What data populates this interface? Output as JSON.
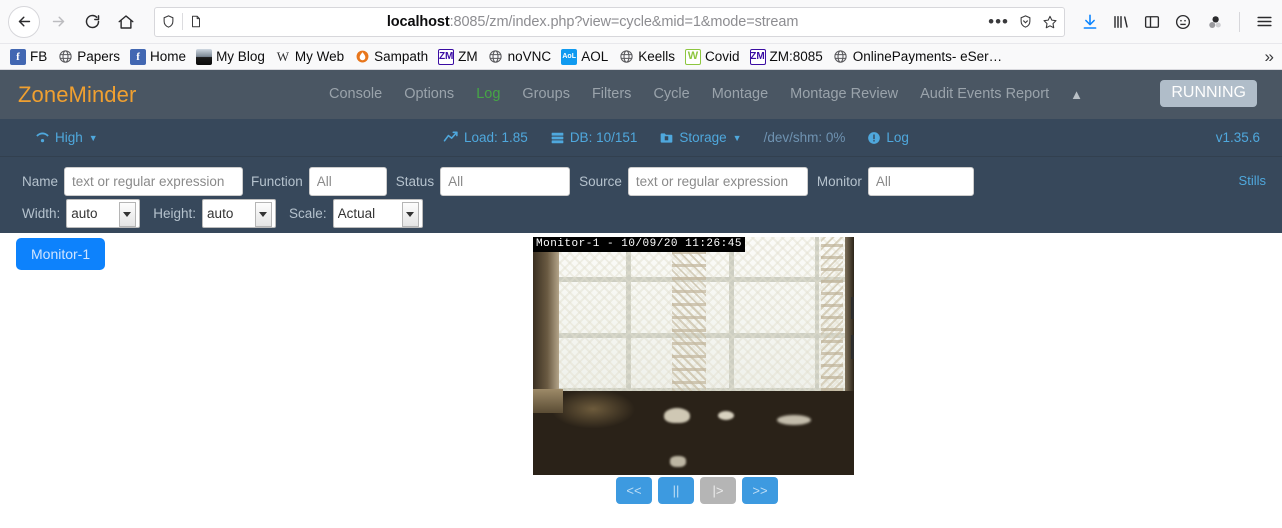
{
  "browser": {
    "url_bold": "localhost",
    "url_rest": ":8085/zm/index.php?view=cycle&mid=1&mode=stream",
    "back_icon": "back-arrow-icon",
    "forward_icon": "forward-arrow-icon",
    "reload_icon": "reload-icon",
    "home_icon": "home-icon",
    "shield_icon": "shield-icon",
    "page_icon": "page-icon",
    "more_icon": "ellipsis-icon",
    "pocket_icon": "pocket-icon",
    "star_icon": "star-icon",
    "download_icon": "download-icon",
    "library_icon": "library-icon",
    "sidebar_icon": "sidebar-icon",
    "account_icon": "account-icon",
    "container_icon": "container-icon",
    "menu_icon": "hamburger-menu-icon"
  },
  "bookmarks": {
    "items": [
      {
        "label": "FB",
        "icon": "facebook-icon"
      },
      {
        "label": "Papers",
        "icon": "globe-icon"
      },
      {
        "label": "Home",
        "icon": "facebook-icon"
      },
      {
        "label": "My Blog",
        "icon": "photo-icon"
      },
      {
        "label": "My Web",
        "icon": "w-icon"
      },
      {
        "label": "Sampath",
        "icon": "sampath-icon"
      },
      {
        "label": "ZM",
        "icon": "zm-icon"
      },
      {
        "label": "noVNC",
        "icon": "globe-icon"
      },
      {
        "label": "AOL",
        "icon": "aol-icon"
      },
      {
        "label": "Keells",
        "icon": "globe-icon"
      },
      {
        "label": "Covid",
        "icon": "covid-icon"
      },
      {
        "label": "ZM:8085",
        "icon": "zm-icon"
      },
      {
        "label": "OnlinePayments- eSer…",
        "icon": "globe-icon"
      }
    ],
    "overflow_icon": "chevron-double-right-icon"
  },
  "header": {
    "brand": "ZoneMinder",
    "nav": [
      {
        "label": "Console",
        "active": false
      },
      {
        "label": "Options",
        "active": false
      },
      {
        "label": "Log",
        "active": true
      },
      {
        "label": "Groups",
        "active": false
      },
      {
        "label": "Filters",
        "active": false
      },
      {
        "label": "Cycle",
        "active": false
      },
      {
        "label": "Montage",
        "active": false
      },
      {
        "label": "Montage Review",
        "active": false
      },
      {
        "label": "Audit Events Report",
        "active": false
      }
    ],
    "collapse_icon": "chevron-up-icon",
    "state_badge": "RUNNING",
    "brand_color": "#f0a030",
    "active_color": "#46a546",
    "bar_color": "#4a5663"
  },
  "status": {
    "bandwidth_label": "High",
    "bandwidth_icon": "wifi-icon",
    "load_label": "Load: 1.85",
    "load_icon": "trending-up-icon",
    "db_label": "DB: 10/151",
    "db_icon": "database-icon",
    "storage_label": "Storage",
    "storage_icon": "folder-icon",
    "shm_label": "/dev/shm: 0%",
    "log_label": "Log",
    "log_icon": "info-circle-icon",
    "version": "v1.35.6",
    "accent": "#4fa8dd",
    "bar_color": "#37485b"
  },
  "filters": {
    "name_label": "Name",
    "name_placeholder": "text or regular expression",
    "name_value": "",
    "function_label": "Function",
    "function_placeholder": "All",
    "function_value": "",
    "status_label": "Status",
    "status_placeholder": "All",
    "status_value": "",
    "source_label": "Source",
    "source_placeholder": "text or regular expression",
    "source_value": "",
    "monitor_label": "Monitor",
    "monitor_placeholder": "All",
    "monitor_value": "",
    "width_label": "Width:",
    "width_value": "auto",
    "height_label": "Height:",
    "height_value": "auto",
    "scale_label": "Scale:",
    "scale_value": "Actual",
    "stills_label": "Stills"
  },
  "content": {
    "monitor_button": "Monitor-1",
    "video_overlay": "Monitor-1 - 10/09/20 11:26:45",
    "controls": [
      {
        "label": "<<",
        "name": "prev-button",
        "disabled": false
      },
      {
        "label": "||",
        "name": "pause-button",
        "disabled": false
      },
      {
        "label": "|>",
        "name": "play-button",
        "disabled": true
      },
      {
        "label": ">>",
        "name": "next-button",
        "disabled": false
      }
    ]
  }
}
